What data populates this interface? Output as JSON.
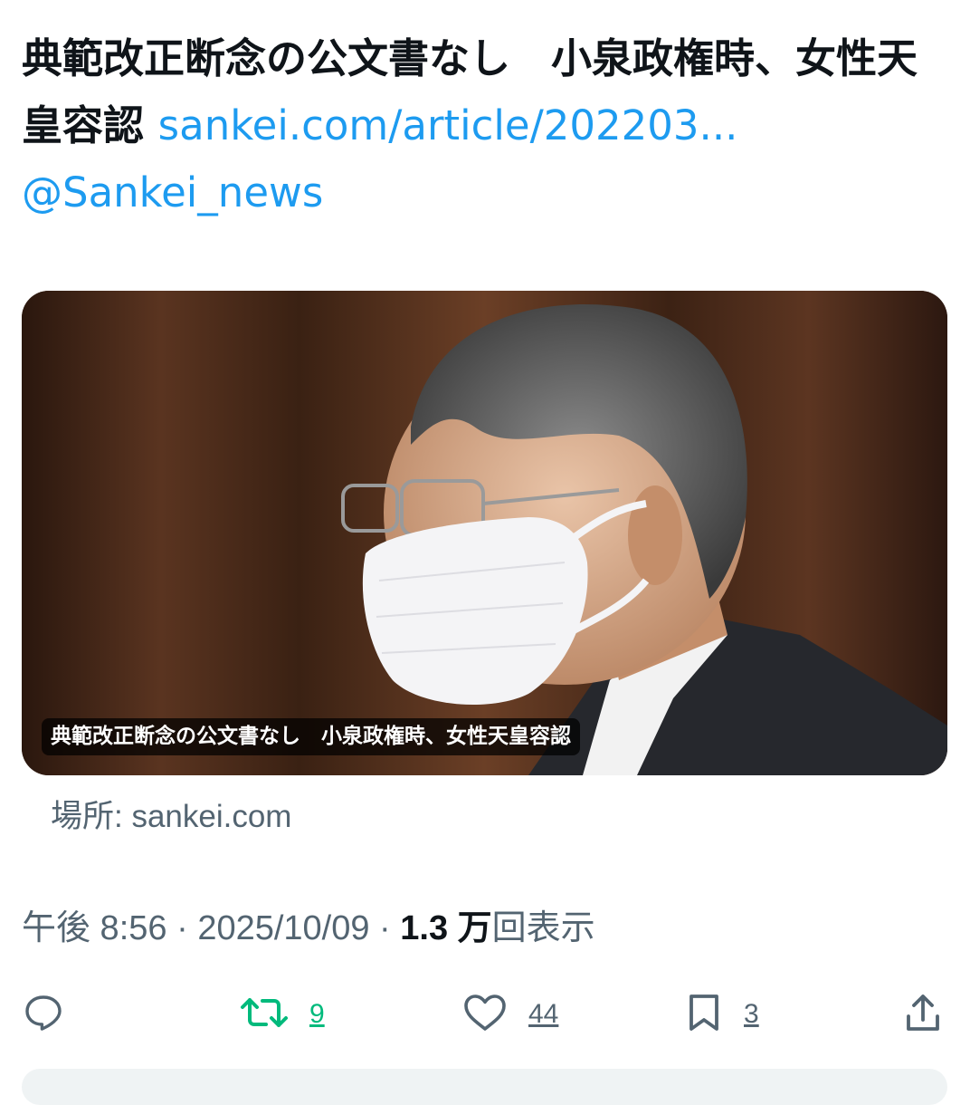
{
  "tweet": {
    "text": "典範改正断念の公文書なし　小泉政権時、女性天皇容認 ",
    "link_text": "sankei.com/article/202203...",
    "mention": "@Sanke​i_news"
  },
  "card": {
    "caption": "典範改正断念の公文書なし　小泉政権時、女性天皇容認",
    "source_label": "場所: sankei.com"
  },
  "meta": {
    "time": "午後 8:56",
    "sep1": " · ",
    "date": "2025/10/09",
    "sep2": " · ",
    "views_count": "1.3 万",
    "views_label": "回表示"
  },
  "actions": {
    "reply": {
      "icon": "reply-icon",
      "count": ""
    },
    "retweet": {
      "icon": "retweet-icon",
      "count": "9"
    },
    "like": {
      "icon": "heart-icon",
      "count": "44"
    },
    "bookmark": {
      "icon": "bookmark-icon",
      "count": "3"
    },
    "share": {
      "icon": "share-icon"
    }
  },
  "colors": {
    "link": "#1d9bf0",
    "retweet": "#00ba7c",
    "secondary": "#536471"
  }
}
